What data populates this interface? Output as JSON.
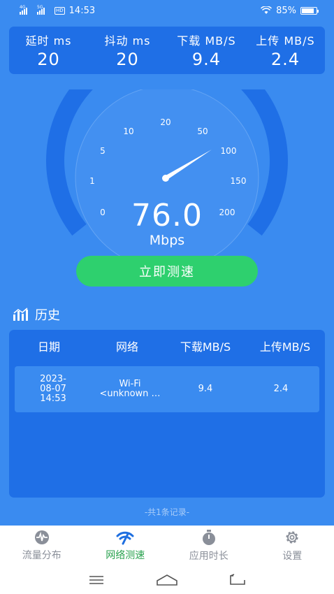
{
  "status_bar": {
    "net1": "4G",
    "net2": "5G",
    "hd": "HD",
    "time": "14:53",
    "battery": "85%",
    "battery_level": 0.85
  },
  "metrics": [
    {
      "label": "延时 ms",
      "value": "20"
    },
    {
      "label": "抖动 ms",
      "value": "20"
    },
    {
      "label": "下载 MB/S",
      "value": "9.4"
    },
    {
      "label": "上传 MB/S",
      "value": "2.4"
    }
  ],
  "gauge": {
    "ticks": [
      "0",
      "1",
      "5",
      "10",
      "20",
      "50",
      "100",
      "150",
      "200"
    ],
    "speed": "76.0",
    "unit": "Mbps",
    "colors": {
      "arc": "#1f6fe6",
      "inner": "#4a95f2",
      "needle": "#ffffff"
    }
  },
  "test_button": {
    "label": "立即测速",
    "color": "#2ed06e"
  },
  "history": {
    "title": "历史",
    "columns": [
      "日期",
      "网络",
      "下载MB/S",
      "上传MB/S"
    ],
    "rows": [
      {
        "date_l1": "2023-",
        "date_l2": "08-07",
        "date_l3": "14:53",
        "net_l1": "Wi-Fi",
        "net_l2": "<unknown …",
        "down": "9.4",
        "up": "2.4"
      }
    ],
    "count_text": "-共1条记录-"
  },
  "bottom_nav": [
    {
      "label": "流量分布",
      "icon": "traffic-wave-icon",
      "active": false
    },
    {
      "label": "网络测速",
      "icon": "wifi-speed-icon",
      "active": true
    },
    {
      "label": "应用时长",
      "icon": "timer-icon",
      "active": false
    },
    {
      "label": "设置",
      "icon": "gear-icon",
      "active": false
    }
  ]
}
